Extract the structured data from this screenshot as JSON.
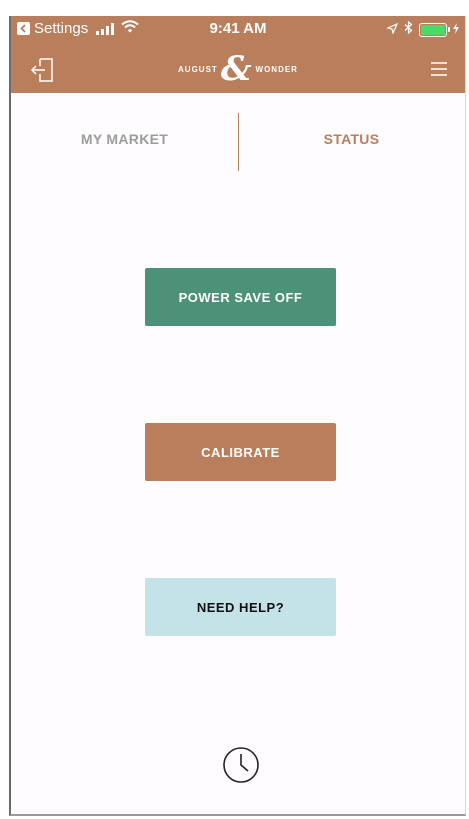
{
  "status_bar": {
    "back_app": "Settings",
    "time": "9:41 AM"
  },
  "header": {
    "brand_left": "AUGUST",
    "brand_amp": "&",
    "brand_right": "WONDER"
  },
  "tabs": [
    {
      "label": "MY MARKET",
      "active": false
    },
    {
      "label": "STATUS",
      "active": true
    }
  ],
  "actions": {
    "power_save": "POWER SAVE OFF",
    "calibrate": "CALIBRATE",
    "help": "NEED HELP?"
  },
  "icons": {
    "login": "login-icon",
    "menu": "hamburger-menu-icon",
    "clock": "clock-icon",
    "back": "back-arrow-icon",
    "signal": "signal-icon",
    "wifi": "wifi-icon",
    "location": "location-icon",
    "bluetooth": "bluetooth-icon",
    "battery": "battery-icon"
  },
  "colors": {
    "brand": "#b97e5c",
    "power_save": "#4b9278",
    "help": "#c3e3e9",
    "battery_fill": "#4cd964"
  },
  "battery_level": 1.0
}
